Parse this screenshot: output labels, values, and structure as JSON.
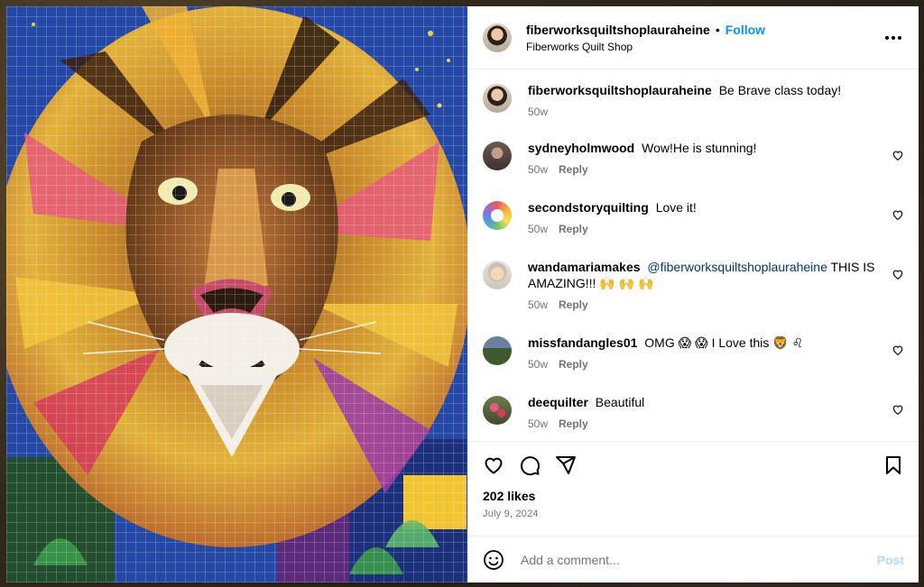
{
  "post": {
    "username": "fiberworksquiltshoplauraheine",
    "separator": "•",
    "follow_label": "Follow",
    "location": "Fiberworks Quilt Shop",
    "more_icon": "more-horizontal-icon"
  },
  "caption": {
    "username": "fiberworksquiltshoplauraheine",
    "text": "Be Brave class today!",
    "time": "50w"
  },
  "comments": [
    {
      "username": "sydneyholmwood",
      "text": "Wow!He is stunning!",
      "time": "50w",
      "reply": "Reply"
    },
    {
      "username": "secondstoryquilting",
      "text": "Love it!",
      "time": "50w",
      "reply": "Reply"
    },
    {
      "username": "wandamariamakes",
      "mention": "@fiberworksquiltshoplauraheine",
      "text": "THIS IS AMAZING!!! 🙌 🙌 🙌",
      "time": "50w",
      "reply": "Reply"
    },
    {
      "username": "missfandangles01",
      "text": "OMG 😱  😱  I Love this 🦁 ♌",
      "time": "50w",
      "reply": "Reply"
    },
    {
      "username": "deequilter",
      "text": "Beautiful",
      "time": "50w",
      "reply": "Reply"
    }
  ],
  "actions": {
    "likes": "202 likes",
    "date": "July 9, 2024"
  },
  "add_comment": {
    "placeholder": "Add a comment...",
    "post_label": "Post"
  },
  "colors": {
    "accent": "#0095f6",
    "post_disabled": "#b3dbff",
    "meta_gray": "#737373"
  }
}
